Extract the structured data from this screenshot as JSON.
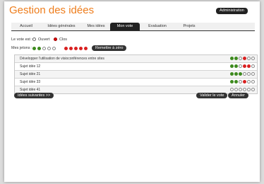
{
  "header": {
    "title": "Gestion des idées",
    "admin_label": "Administration"
  },
  "tabs": [
    {
      "label": "Accueil",
      "active": false
    },
    {
      "label": "Idées générales",
      "active": false
    },
    {
      "label": "Mes idées",
      "active": false
    },
    {
      "label": "Mon vote",
      "active": true
    },
    {
      "label": "Evaluation",
      "active": false
    },
    {
      "label": "Projets",
      "active": false
    }
  ],
  "vote_status": {
    "label": "Le vote est :",
    "options": [
      "Ouvert",
      "Clos"
    ],
    "selected": "Clos"
  },
  "jetons": {
    "label": "Mes jetons :",
    "green_filled": 2,
    "green_total": 5,
    "red_filled": 5,
    "red_total": 5,
    "reset_label": "Remettre à zéro"
  },
  "ideas": [
    {
      "title": "Développer l'utilisation de visioconférences entre sites",
      "votes": [
        "green",
        "green",
        "empty",
        "red",
        "empty",
        "empty"
      ]
    },
    {
      "title": "Sujet idée 12",
      "votes": [
        "green",
        "green",
        "empty",
        "red",
        "red",
        "empty"
      ]
    },
    {
      "title": "Sujet idée 21",
      "votes": [
        "green",
        "green",
        "green",
        "empty",
        "empty",
        "empty"
      ]
    },
    {
      "title": "Sujet idée 33",
      "votes": [
        "green",
        "green",
        "empty",
        "red",
        "empty",
        "empty"
      ]
    },
    {
      "title": "Sujet idée 41",
      "votes": [
        "empty",
        "empty",
        "empty",
        "empty",
        "empty",
        "empty"
      ]
    }
  ],
  "footer": {
    "next_label": "Idées suivantes >>",
    "validate_label": "Valider le vote",
    "cancel_label": "Annuler"
  },
  "colors": {
    "accent": "#ee7d1c",
    "green": "#3d8a1e",
    "red": "#d92020",
    "dark": "#222222"
  }
}
